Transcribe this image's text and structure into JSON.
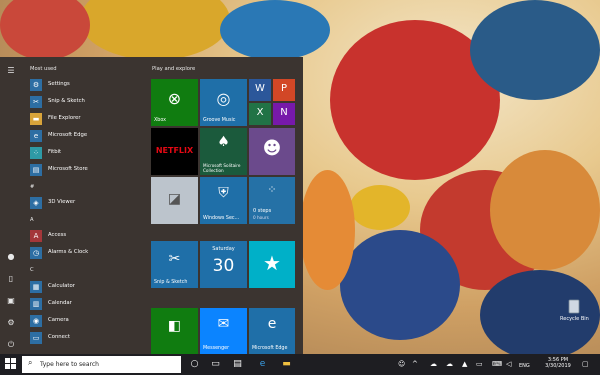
{
  "start_menu": {
    "most_used_header": "Most used",
    "most_used": [
      {
        "label": "Settings",
        "icon": "gear-icon"
      },
      {
        "label": "Snip & Sketch",
        "icon": "snip-icon"
      },
      {
        "label": "File Explorer",
        "icon": "folder-icon"
      },
      {
        "label": "Microsoft Edge",
        "icon": "edge-icon"
      },
      {
        "label": "Fitbit",
        "icon": "fitbit-icon"
      },
      {
        "label": "Microsoft Store",
        "icon": "store-icon"
      }
    ],
    "sections": [
      {
        "header": "#",
        "items": [
          {
            "label": "3D Viewer",
            "icon": "cube-icon"
          }
        ]
      },
      {
        "header": "A",
        "items": [
          {
            "label": "Access",
            "icon": "access-icon"
          },
          {
            "label": "Alarms & Clock",
            "icon": "clock-icon"
          }
        ]
      },
      {
        "header": "C",
        "items": [
          {
            "label": "Calculator",
            "icon": "calculator-icon"
          },
          {
            "label": "Calendar",
            "icon": "calendar-icon"
          },
          {
            "label": "Camera",
            "icon": "camera-icon"
          },
          {
            "label": "Connect",
            "icon": "connect-icon"
          }
        ]
      }
    ],
    "tiles_header": "Play and explore",
    "tiles": {
      "xbox": "Xbox",
      "groove": "Groove Music",
      "netflix": "NETFLIX",
      "solitaire": "Microsoft Solitaire Collection",
      "security": "Windows Sec...",
      "steps_value": "0 steps",
      "steps_sub": "0 hours",
      "snip": "Snip & Sketch",
      "cal_day": "Saturday",
      "cal_date": "30",
      "messenger": "Messenger",
      "edge": "Microsoft Edge"
    }
  },
  "taskbar": {
    "search_placeholder": "Type here to search",
    "language": "ENG",
    "time": "3:56 PM",
    "date": "3/30/2019"
  },
  "desktop": {
    "recycle_bin": "Recycle Bin"
  },
  "colors": {
    "accent": "#1273ba",
    "menu_bg": "#3b3430",
    "taskbar_bg": "#1e1e22"
  }
}
